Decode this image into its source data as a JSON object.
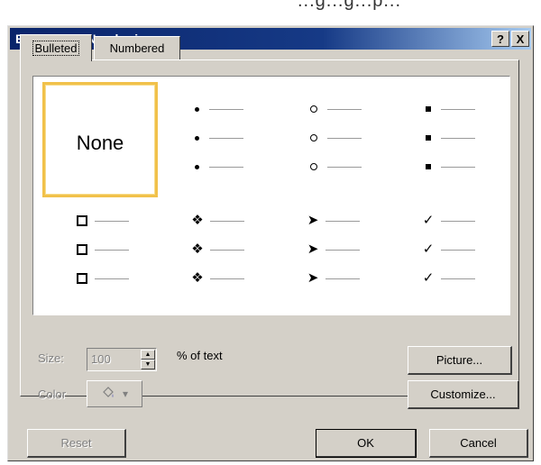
{
  "background_text": "...g...g...p...",
  "dialog": {
    "title": "Bullets and Numbering",
    "help_button": "?",
    "close_button": "X"
  },
  "tabs": [
    {
      "label": "Bulleted",
      "active": true
    },
    {
      "label": "Numbered",
      "active": false
    }
  ],
  "gallery": {
    "none_label": "None",
    "selected": "None",
    "styles": [
      "none",
      "filled-dot",
      "hollow-circle",
      "filled-square",
      "hollow-square",
      "four-diamond",
      "arrowhead",
      "checkmark"
    ],
    "glyphs": {
      "four_diamond": "❖",
      "arrowhead": "➤",
      "checkmark": "✓"
    }
  },
  "size": {
    "label": "Size:",
    "value": "100",
    "suffix": "% of text"
  },
  "color": {
    "label": "Color"
  },
  "buttons": {
    "picture": "Picture...",
    "customize": "Customize...",
    "reset": "Reset",
    "ok": "OK",
    "cancel": "Cancel"
  }
}
